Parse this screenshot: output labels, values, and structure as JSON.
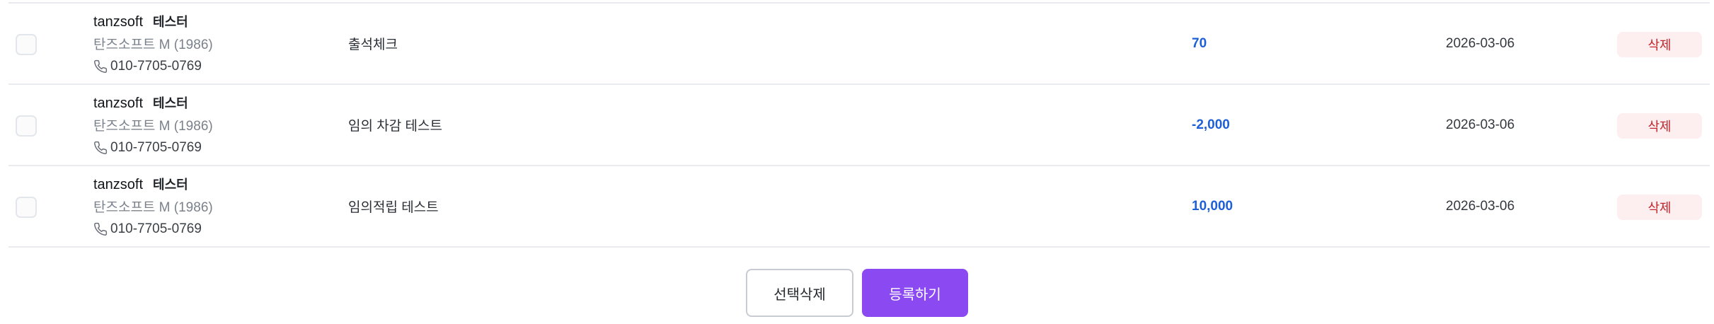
{
  "rows": [
    {
      "name": "tanzsoft",
      "tag": "테스터",
      "sub": "탄즈소프트 M (1986)",
      "phone": "010-7705-0769",
      "description": "출석체크",
      "amount": "70",
      "date": "2026-03-06",
      "delete_label": "삭제"
    },
    {
      "name": "tanzsoft",
      "tag": "테스터",
      "sub": "탄즈소프트 M (1986)",
      "phone": "010-7705-0769",
      "description": "임의 차감 테스트",
      "amount": "-2,000",
      "date": "2026-03-06",
      "delete_label": "삭제"
    },
    {
      "name": "tanzsoft",
      "tag": "테스터",
      "sub": "탄즈소프트 M (1986)",
      "phone": "010-7705-0769",
      "description": "임의적립 테스트",
      "amount": "10,000",
      "date": "2026-03-06",
      "delete_label": "삭제"
    }
  ],
  "footer": {
    "delete_selected_label": "선택삭제",
    "register_label": "등록하기"
  },
  "colors": {
    "amount": "#1d5fd6",
    "delete_text": "#c2262d",
    "delete_bg": "#fdeff0",
    "primary": "#8b4af1"
  },
  "icons": {
    "phone": "phone-icon"
  }
}
